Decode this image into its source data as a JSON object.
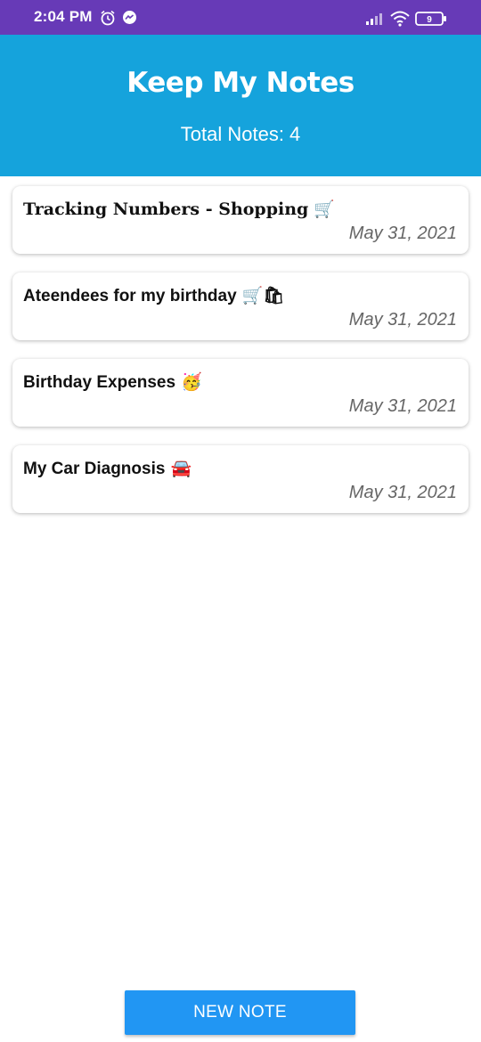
{
  "status_bar": {
    "time": "2:04 PM",
    "battery": "9",
    "icons": [
      "alarm-icon",
      "messenger-icon",
      "signal-icon",
      "wifi-icon",
      "battery-icon"
    ],
    "color": "#673ab7"
  },
  "header": {
    "title": "Keep My Notes",
    "total_label": "Total Notes:",
    "total_count": "4",
    "color": "#15a3dc"
  },
  "notes": [
    {
      "title": "Tracking Numbers - Shopping",
      "emoji": "🛒",
      "date": "May 31, 2021"
    },
    {
      "title": "Ateendees for my birthday",
      "emoji": "🛒🛍",
      "date": "May 31, 2021"
    },
    {
      "title": "Birthday Expenses",
      "emoji": "🥳",
      "date": "May 31, 2021"
    },
    {
      "title": "My Car Diagnosis",
      "emoji": "🚘",
      "date": "May 31, 2021"
    }
  ],
  "actions": {
    "new_note_label": "NEW NOTE",
    "color": "#2196f3"
  }
}
